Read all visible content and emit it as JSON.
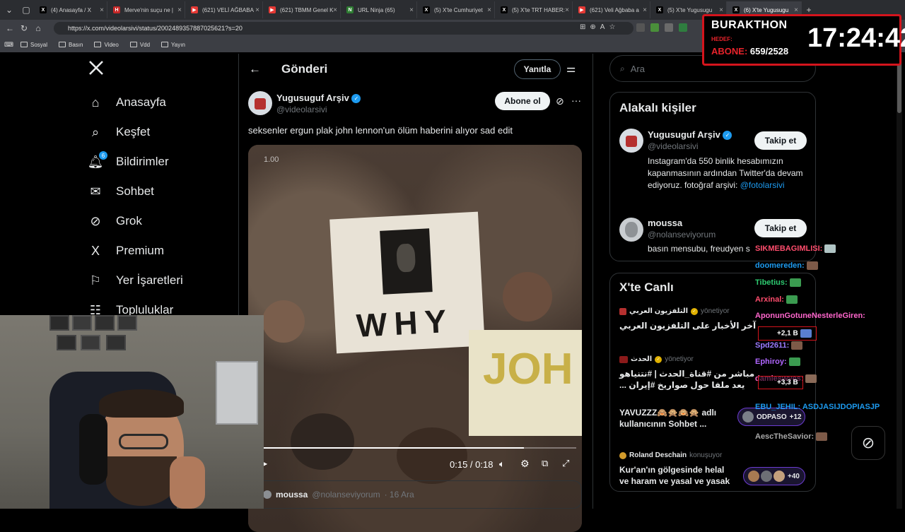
{
  "tabs": [
    {
      "label": "(4) Anasayfa / X",
      "favicon": "x"
    },
    {
      "label": "Merve'nin suçu ne |",
      "favicon": "h"
    },
    {
      "label": "(621) VELİ AĞBABA",
      "favicon": "yt"
    },
    {
      "label": "(621) TBMM Genel K",
      "favicon": "yt"
    },
    {
      "label": "URL Ninja (65)",
      "favicon": "ninja"
    },
    {
      "label": "(5) X'te Cumhuriyet",
      "favicon": "x"
    },
    {
      "label": "(5) X'te TRT HABER:",
      "favicon": "x"
    },
    {
      "label": "(621) Veli Ağbaba a",
      "favicon": "yt"
    },
    {
      "label": "(5) X'te Yugusugu",
      "favicon": "x"
    },
    {
      "label": "(6) X'te Yugusugu",
      "favicon": "x"
    }
  ],
  "address": {
    "url": "https://x.com/videolarsivi/status/2002489357887025621?s=20"
  },
  "bookmarks": [
    "Sosyal",
    "Basın",
    "Video",
    "Vdd",
    "Yayın"
  ],
  "nav": {
    "items": [
      {
        "label": "Anasayfa",
        "icon": "home-icon"
      },
      {
        "label": "Keşfet",
        "icon": "search-icon"
      },
      {
        "label": "Bildirimler",
        "icon": "bell-icon",
        "badge": "6"
      },
      {
        "label": "Sohbet",
        "icon": "mail-icon"
      },
      {
        "label": "Grok",
        "icon": "grok-icon"
      },
      {
        "label": "Premium",
        "icon": "x-logo-icon"
      },
      {
        "label": "Yer İşaretleri",
        "icon": "bookmark-icon"
      },
      {
        "label": "Topluluklar",
        "icon": "people-icon"
      }
    ]
  },
  "main": {
    "header_title": "Gönderi",
    "reply_button": "Yanıtla",
    "author_name": "Yugusuguf Arşiv",
    "author_handle": "@videolarsivi",
    "subscribe_button": "Abone ol",
    "tweet_text": "seksenler ergun plak john lennon'un ölüm haberini alıyor sad edit",
    "video": {
      "speed_label": "1.00",
      "time": "0:15 / 0:18",
      "progress": 0.833,
      "sign_text": "WHY",
      "sign2_text": "JOH"
    },
    "reply_preview": {
      "name": "moussa",
      "handle": "@nolanseviyorum",
      "date": "· 16 Ara"
    }
  },
  "search": {
    "placeholder": "Ara"
  },
  "related": {
    "title": "Alakalı kişiler",
    "people": [
      {
        "name": "Yugusuguf Arşiv",
        "handle": "@videolarsivi",
        "button": "Takip et",
        "bio": "Instagram'da 550 binlik hesabımızın kapanmasının ardından Twitter'da devam ediyoruz. fotoğraf arşivi:",
        "bio_link": "@fotolarsivi"
      },
      {
        "name": "moussa",
        "handle": "@nolanseviyorum",
        "button": "Takip et",
        "bio": "basın mensubu, freudyen s"
      }
    ]
  },
  "live": {
    "title": "X'te Canlı",
    "items": [
      {
        "host": "التلفزيون العربي",
        "role": "yönetiyor",
        "text": "آخر الأخبار على التلفزيون العربي"
      },
      {
        "host": "الحدث",
        "role": "yönetiyor",
        "text1": "مباشر من #قناة_الحدث | #نتنياهو",
        "text2": "... يعد ملفا حول صواريخ #إيران"
      },
      {
        "text1": "YAVUZZZ🙈🙊🙉🙊 adlı",
        "text2": "kullanıcının Sohbet ...",
        "count": "+12",
        "count_label": "ODPASO"
      },
      {
        "host": "Roland Deschain",
        "role": "konuşuyor",
        "text1": "Kur'an'ın gölgesinde helal",
        "text2": "ve haram ve yasal ve yasak",
        "count": "+40"
      }
    ]
  },
  "overlay": {
    "channel": "BURAKTHON",
    "target_label": "HEDEF:",
    "subs_label": "ABONE:",
    "subs_value": "659/2528",
    "clock": "17:24:42"
  },
  "chat": [
    {
      "user": "SIKMEBAGIMLISI:",
      "color": "#ff4d6d"
    },
    {
      "user": "doomereden:",
      "color": "#1d9bf0"
    },
    {
      "user": "Tibetius:",
      "color": "#2ecc71"
    },
    {
      "user": "Arxinal:",
      "color": "#ff4d6d"
    },
    {
      "user": "AponunGotuneNesterleGiren:",
      "color": "#ff66cc"
    },
    {
      "user": "+2,1 B",
      "color": "#ffffff"
    },
    {
      "user": "Spd2611:",
      "color": "#9b7bff"
    },
    {
      "user": "Ephiroy:",
      "color": "#b066ff"
    },
    {
      "user": "damleswyes:",
      "color": "#ff66cc"
    },
    {
      "user": "+3,3 B",
      "color": "#ffffff"
    },
    {
      "user": "EBU_JEHIL: ASDJASIJDOPIASJP",
      "color": "#1d9bf0"
    },
    {
      "user": "AescTheSavior:",
      "color": "#aaaaaa"
    }
  ]
}
